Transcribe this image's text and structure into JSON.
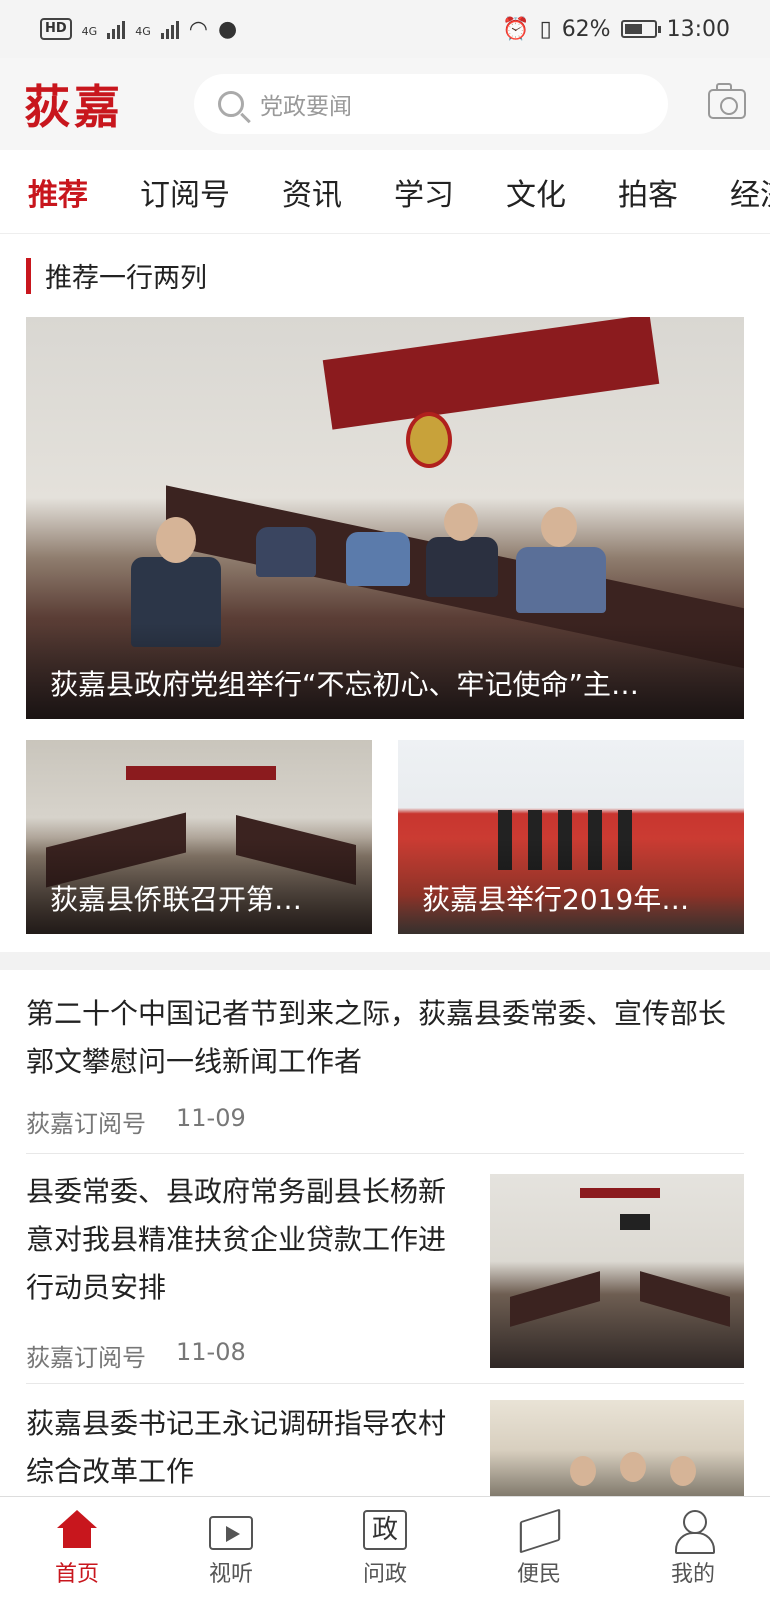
{
  "status_bar": {
    "hd": "HD",
    "sim1": "4G",
    "sim2": "4G",
    "battery": "62%",
    "battery_level": 0.62,
    "time": "13:00"
  },
  "header": {
    "logo": "荻嘉",
    "search_placeholder": "党政要闻"
  },
  "tabs": [
    "推荐",
    "订阅号",
    "资讯",
    "学习",
    "文化",
    "拍客",
    "经济"
  ],
  "active_tab": 0,
  "section": {
    "title": "推荐一行两列"
  },
  "featured": {
    "hero_caption": "荻嘉县政府党组举行“不忘初心、牢记使命”主…",
    "small": [
      {
        "caption": "荻嘉县侨联召开第…"
      },
      {
        "caption": "荻嘉县举行2019年…"
      }
    ]
  },
  "news": [
    {
      "title": "第二十个中国记者节到来之际，荻嘉县委常委、宣传部长郭文攀慰问一线新闻工作者",
      "source": "荻嘉订阅号",
      "date": "11-09"
    },
    {
      "title": "县委常委、县政府常务副县长杨新意对我县精准扶贫企业贷款工作进行动员安排",
      "source": "荻嘉订阅号",
      "date": "11-08"
    },
    {
      "title": "荻嘉县委书记王永记调研指导农村综合改革工作"
    }
  ],
  "bottom_nav": [
    {
      "label": "首页",
      "icon": "home-icon"
    },
    {
      "label": "视听",
      "icon": "tv-icon"
    },
    {
      "label": "问政",
      "icon": "zheng-icon",
      "glyph": "政"
    },
    {
      "label": "便民",
      "icon": "send-icon"
    },
    {
      "label": "我的",
      "icon": "user-icon"
    }
  ],
  "colors": {
    "accent": "#c8161d"
  }
}
